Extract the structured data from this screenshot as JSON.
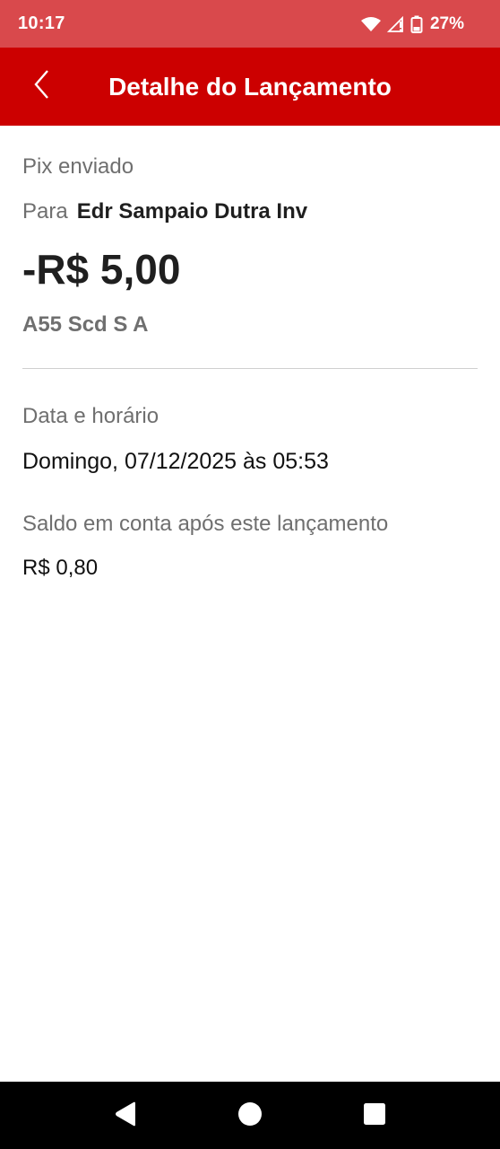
{
  "status_bar": {
    "time": "10:17",
    "battery_percent": "27%",
    "icons": [
      "wifi-icon",
      "signal-icon",
      "battery-icon"
    ]
  },
  "app_bar": {
    "title": "Detalhe do Lançamento",
    "back_icon": "chevron-left-icon",
    "background_color": "#cc0000"
  },
  "transaction": {
    "type": "Pix enviado",
    "recipient_label": "Para",
    "recipient_name": "Edr Sampaio Dutra Inv",
    "amount": "-R$ 5,00",
    "institution": "A55 Scd S A"
  },
  "details": {
    "date_label": "Data e horário",
    "date_value": "Domingo, 07/12/2025 às 05:53",
    "balance_label": "Saldo em conta após este lançamento",
    "balance_value": "R$ 0,80"
  },
  "nav_bar": {
    "icons": [
      "back-triangle-icon",
      "home-circle-icon",
      "recents-square-icon"
    ]
  }
}
